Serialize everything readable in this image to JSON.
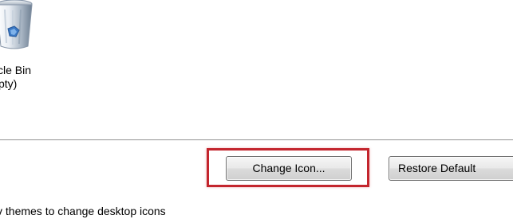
{
  "desktop_icon": {
    "icon": "recycle-bin-icon",
    "label_line1": "cle Bin",
    "label_line2": "pty)"
  },
  "buttons": {
    "change_icon": "Change Icon...",
    "restore_default": "Restore Default"
  },
  "footer": {
    "text": "v themes to change desktop icons"
  },
  "colors": {
    "highlight": "#c3252d",
    "divider": "#a0a0a0"
  }
}
